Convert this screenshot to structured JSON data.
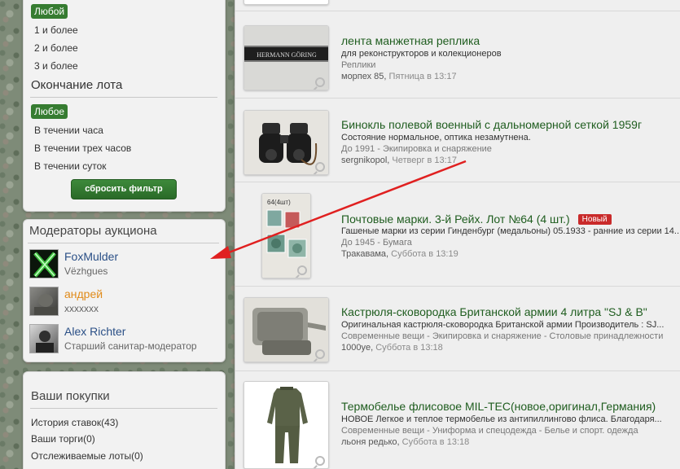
{
  "filter": {
    "rating_options": [
      "Любой",
      "1 и более",
      "2 и более",
      "3 и более"
    ],
    "ending_title": "Окончание лота",
    "ending_options": [
      "Любое",
      "В течении часа",
      "В течении трех часов",
      "В течении суток"
    ],
    "reset_label": "сбросить фильтр"
  },
  "moderators": {
    "title": "Модераторы аукциона",
    "items": [
      {
        "name": "FoxMulder",
        "role": "Vëzhgues"
      },
      {
        "name": "андрей",
        "role": "xxxxxxx"
      },
      {
        "name": "Alex Richter",
        "role": "Старший санитар-модератор"
      }
    ]
  },
  "purchases": {
    "title": "Ваши покупки",
    "links": [
      "История ставок(43)",
      "Ваши торги(0)",
      "Отслеживаемые лоты(0)"
    ]
  },
  "lots": [
    {
      "title": "лента манжетная реплика",
      "desc": "для реконструкторов и колекционеров",
      "category": "Реплики",
      "seller": "морпех 85,",
      "time": "Пятница в 13:17",
      "thumb_text": "HERMANN GÖRING"
    },
    {
      "title": "Бинокль полевой военный с дальномерной сеткой 1959г",
      "desc": "Состояние нормальное, оптика незамутнена.",
      "category": "До 1991 - Экипировка и снаряжение",
      "seller": "sergnikopol,",
      "time": "Четверг в 13:17"
    },
    {
      "title": "Почтовые марки. 3-й Рейх. Лот №64 (4 шт.)",
      "badge": "Новый",
      "desc": "Гашеные марки из серии Гинденбург (медальоны) 05.1933 - ранние из серии 14...",
      "category": "До 1945 - Бумага",
      "seller": "Тракавама,",
      "time": "Суббота в 13:19",
      "thumb_text": "64(4шт)"
    },
    {
      "title": "Кастрюля-сковородка Британской армии 4 литра \"SJ & B\"",
      "desc": "Оригинальная кастрюля-сковородка Британской армии Производитель : SJ...",
      "category": "Современные вещи - Экипировка и снаряжение - Столовые принадлежности",
      "seller": "1000ye,",
      "time": "Суббота в 13:18"
    },
    {
      "title": "Термобелье флисовое MIL-TEC(новое,оригинал,Германия)",
      "desc": "НОВОЕ Легкое и теплое термобелье из антипиллингово флиса. Благодаря...",
      "category": "Современные вещи - Униформа и спецодежда - Белье и спорт. одежда",
      "seller": "льоня редько,",
      "time": "Суббота в 13:18"
    }
  ],
  "colors": {
    "accent_green": "#367c31",
    "title_green": "#1f5d1f",
    "badge_red": "#c92a2a",
    "arrow_red": "#e02020"
  }
}
